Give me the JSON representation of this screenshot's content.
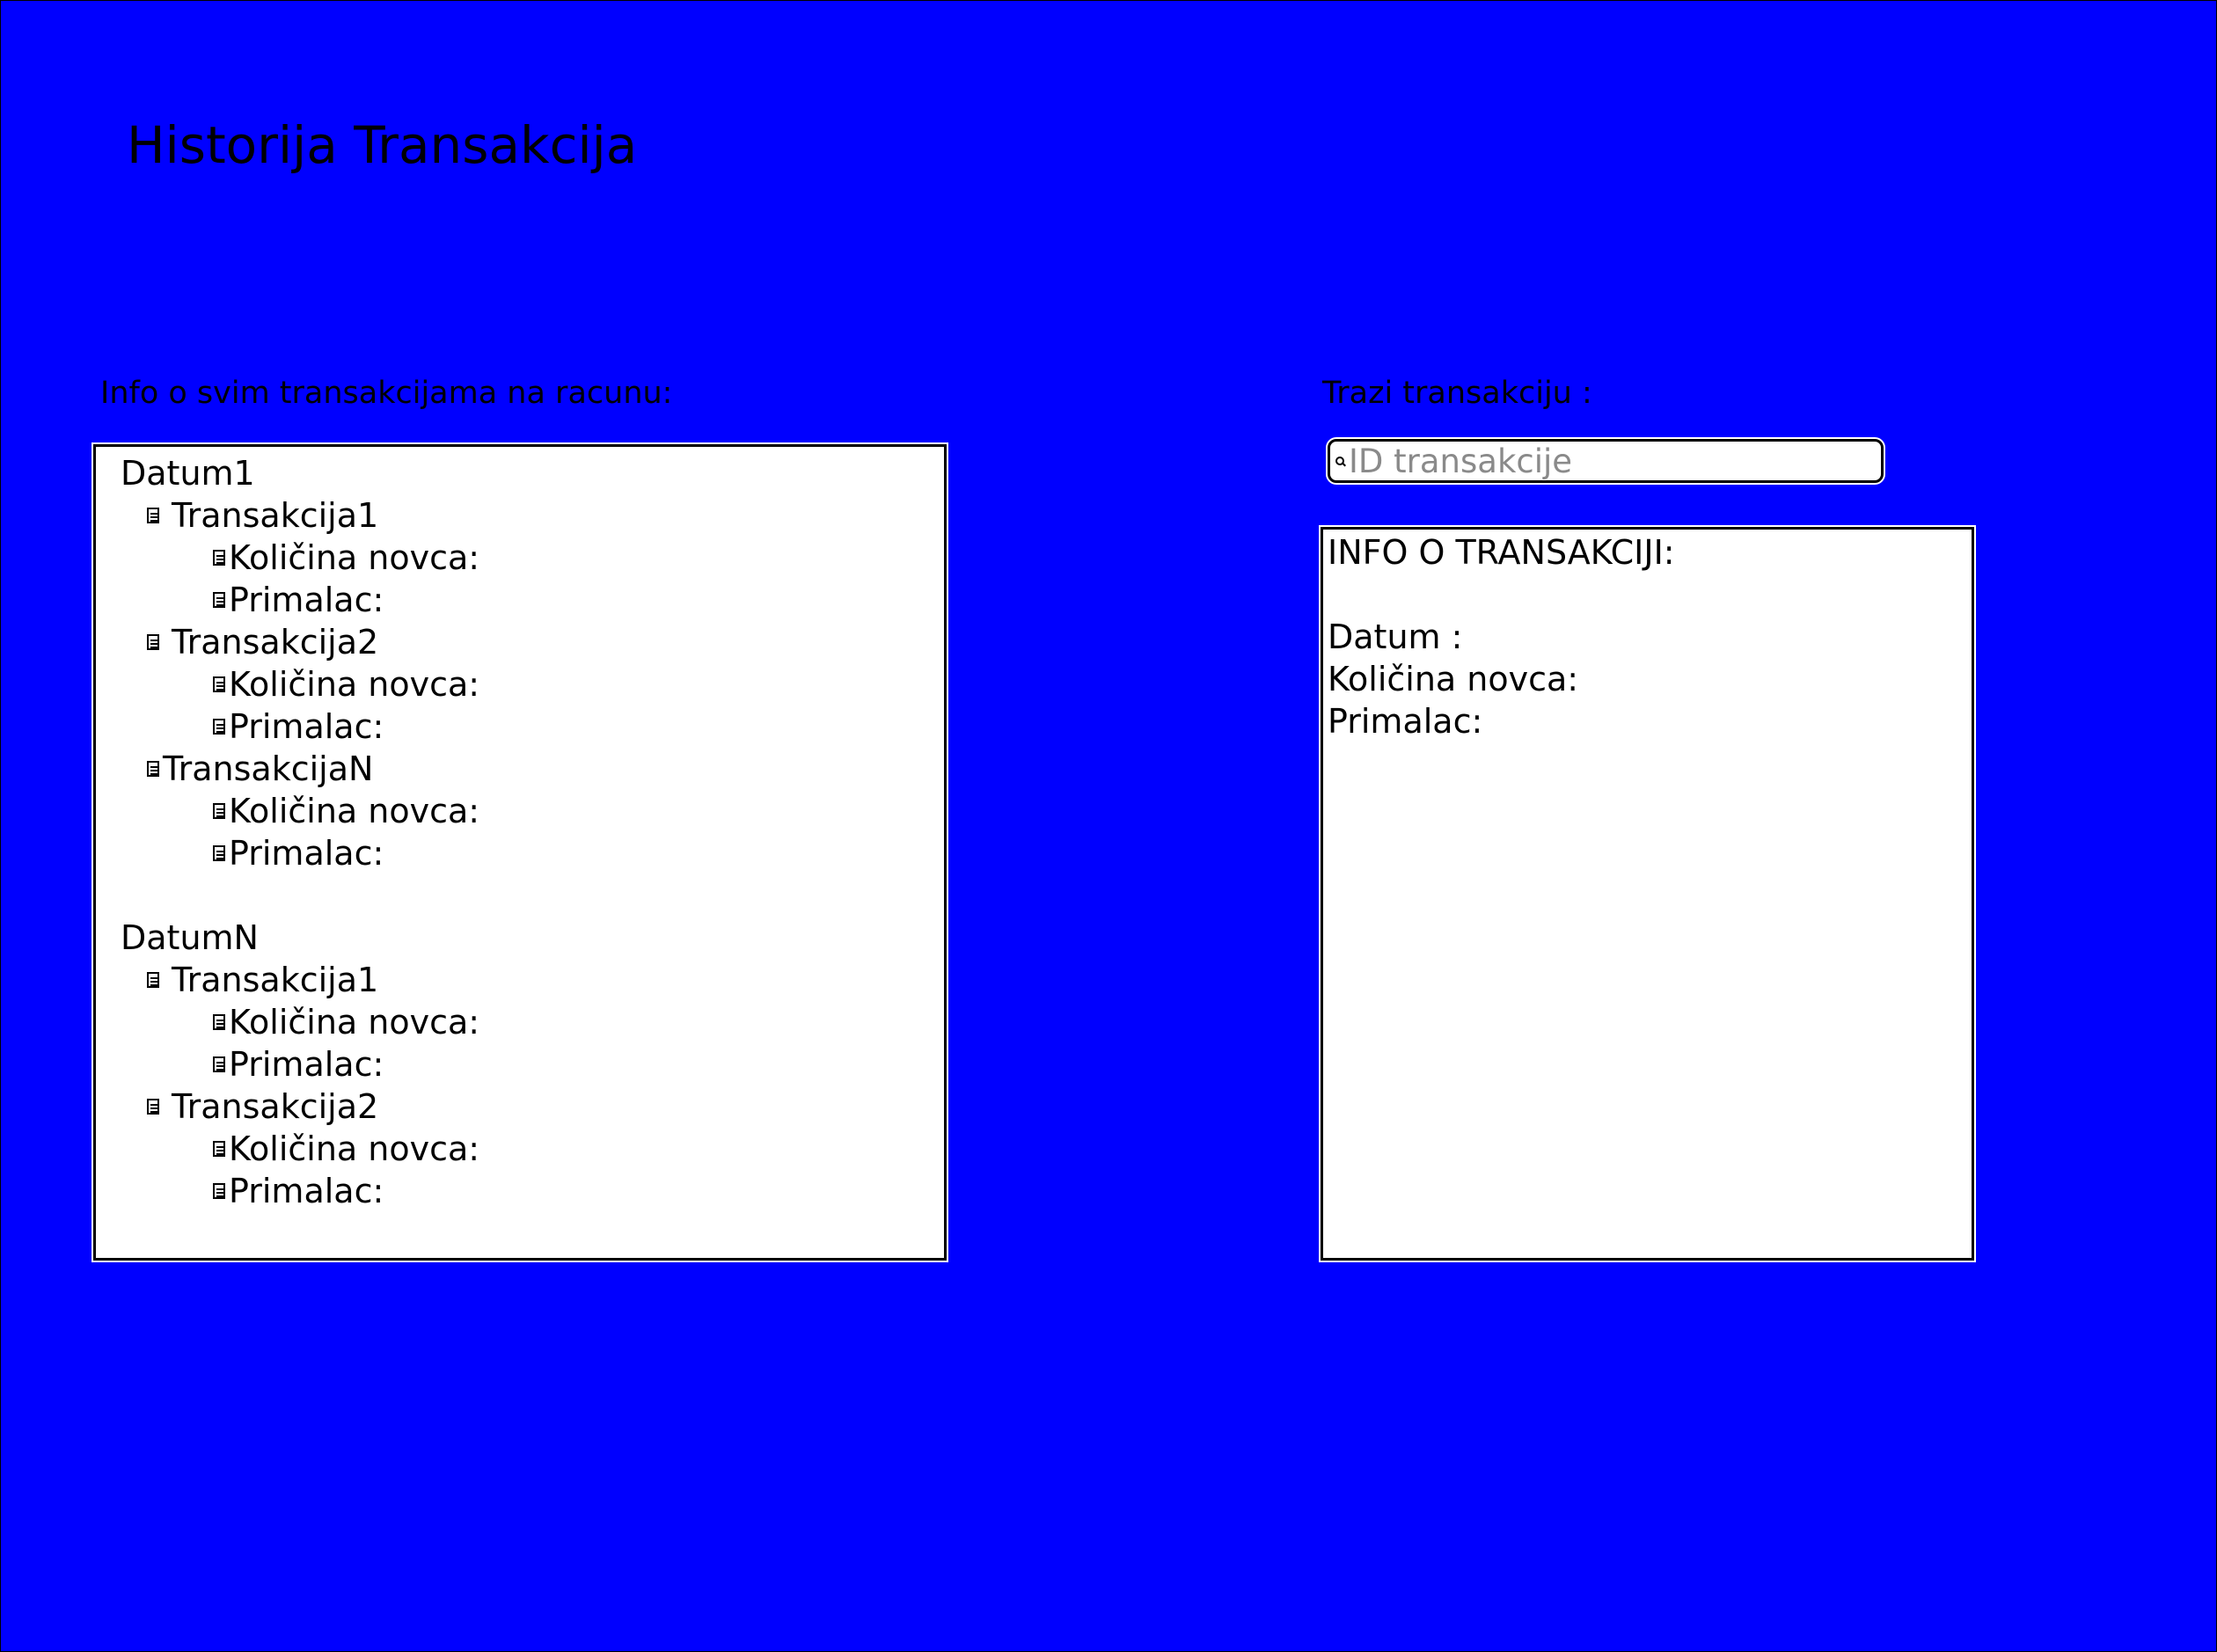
{
  "page": {
    "title": "Historija Transakcija"
  },
  "left_section": {
    "label": "Info o svim transakcijama na racunu:",
    "tree": {
      "date1": "Datum1",
      "t1": "Transakcija1",
      "t1_amount": "Količina novca:",
      "t1_recipient": "Primalac:",
      "t2": "Transakcija2",
      "t2_amount": "Količina novca:",
      "t2_recipient": "Primalac:",
      "tn": "TransakcijaN",
      "tn_amount": "Količina novca:",
      "tn_recipient": "Primalac:",
      "dateN": "DatumN",
      "dn_t1": "Transakcija1",
      "dn_t1_amount": "Količina novca:",
      "dn_t1_recipient": "Primalac:",
      "dn_t2": "Transakcija2",
      "dn_t2_amount": "Količina novca:",
      "dn_t2_recipient": "Primalac:"
    }
  },
  "right_section": {
    "label": "Trazi transakciju :",
    "search": {
      "placeholder": "ID transakcije",
      "value": ""
    },
    "info": {
      "header": "INFO O TRANSAKCIJI:",
      "date_label": "Datum :",
      "amount_label": "Količina novca:",
      "recipient_label": "Primalac:"
    }
  },
  "icons": {
    "tree_item": "document-icon",
    "search": "search-icon"
  },
  "colors": {
    "background": "#0000ff",
    "panel": "#ffffff",
    "text": "#000000",
    "placeholder": "#8a8a8a"
  }
}
